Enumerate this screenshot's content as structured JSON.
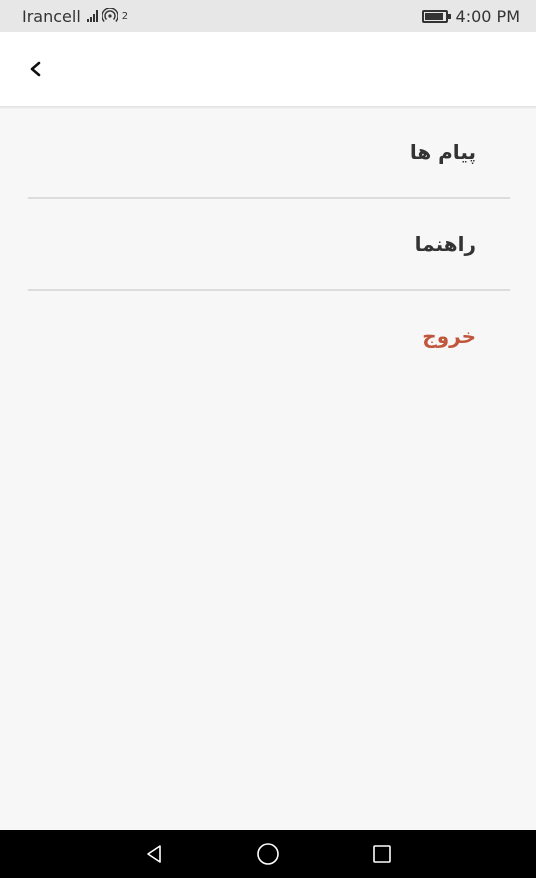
{
  "status_bar": {
    "carrier": "Irancell",
    "wifi_superscript": "2",
    "time": "4:00 PM",
    "icons": [
      "signal-icon",
      "wifi-hotspot-icon",
      "battery-icon"
    ]
  },
  "app_bar": {
    "back_icon": "chevron-left-icon"
  },
  "menu": {
    "items": [
      {
        "label": "پیام ها"
      },
      {
        "label": "راهنما"
      },
      {
        "label": "خروج"
      }
    ],
    "danger_color": "#c0573d"
  },
  "nav_bar": {
    "icons": [
      "back-triangle-icon",
      "home-circle-icon",
      "recents-square-icon"
    ]
  }
}
